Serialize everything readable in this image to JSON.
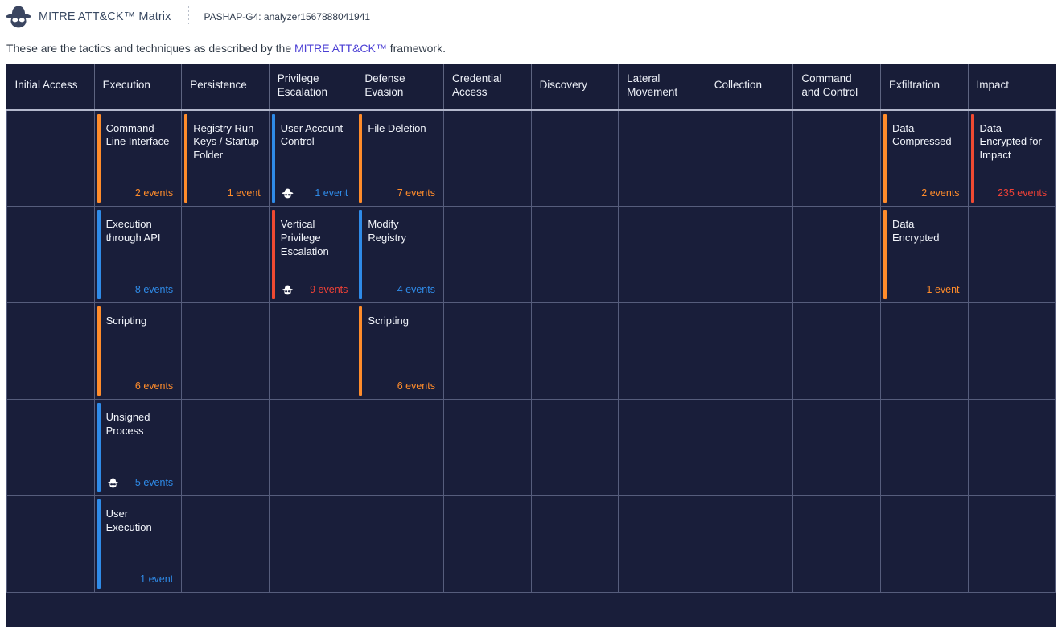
{
  "header": {
    "logo_icon": "spy-icon",
    "title": "MITRE ATT&CK™ Matrix",
    "analyzer_id": "PASHAP-G4: analyzer1567888041941"
  },
  "description": {
    "prefix": "These are the tactics and techniques as described by the ",
    "link_text": "MITRE ATT&CK™",
    "suffix": " framework."
  },
  "colors": {
    "orange": "#ff8c2b",
    "blue": "#2f8be8",
    "red": "#f04a32",
    "red_text": "#ef4136",
    "table_bg": "#191e3a",
    "header_bg": "#181d38",
    "link": "#4b3fd4"
  },
  "matrix": {
    "columns": [
      "Initial Access",
      "Execution",
      "Persistence",
      "Privilege Escalation",
      "Defense Evasion",
      "Credential Access",
      "Discovery",
      "Lateral Movement",
      "Collection",
      "Command and Control",
      "Exfiltration",
      "Impact"
    ],
    "rows": [
      [
        null,
        {
          "name": "Command-Line Interface",
          "events": "2 events",
          "bar": "#ff8c2b",
          "event_color": "#ff8c2b",
          "icon": null
        },
        {
          "name": "Registry Run Keys / Startup Folder",
          "events": "1 event",
          "bar": "#ff8c2b",
          "event_color": "#ff8c2b",
          "icon": null
        },
        {
          "name": "User Account Control",
          "events": "1 event",
          "bar": "#2f8be8",
          "event_color": "#2f8be8",
          "icon": "spy-icon"
        },
        {
          "name": "File Deletion",
          "events": "7 events",
          "bar": "#ff8c2b",
          "event_color": "#ff8c2b",
          "icon": null
        },
        null,
        null,
        null,
        null,
        null,
        {
          "name": "Data Compressed",
          "events": "2 events",
          "bar": "#ff8c2b",
          "event_color": "#ff8c2b",
          "icon": null
        },
        {
          "name": "Data Encrypted for Impact",
          "events": "235 events",
          "bar": "#f04a32",
          "event_color": "#ef4136",
          "icon": null
        }
      ],
      [
        null,
        {
          "name": "Execution through API",
          "events": "8 events",
          "bar": "#2f8be8",
          "event_color": "#2f8be8",
          "icon": null
        },
        null,
        {
          "name": "Vertical Privilege Escalation",
          "events": "9 events",
          "bar": "#f04a32",
          "event_color": "#ef4136",
          "icon": "spy-icon"
        },
        {
          "name": "Modify Registry",
          "events": "4 events",
          "bar": "#2f8be8",
          "event_color": "#2f8be8",
          "icon": null
        },
        null,
        null,
        null,
        null,
        null,
        {
          "name": "Data Encrypted",
          "events": "1 event",
          "bar": "#ff8c2b",
          "event_color": "#ff8c2b",
          "icon": null
        },
        null
      ],
      [
        null,
        {
          "name": "Scripting",
          "events": "6 events",
          "bar": "#ff8c2b",
          "event_color": "#ff8c2b",
          "icon": null
        },
        null,
        null,
        {
          "name": "Scripting",
          "events": "6 events",
          "bar": "#ff8c2b",
          "event_color": "#ff8c2b",
          "icon": null
        },
        null,
        null,
        null,
        null,
        null,
        null,
        null
      ],
      [
        null,
        {
          "name": "Unsigned Process",
          "events": "5 events",
          "bar": "#2f8be8",
          "event_color": "#2f8be8",
          "icon": "spy-icon"
        },
        null,
        null,
        null,
        null,
        null,
        null,
        null,
        null,
        null,
        null
      ],
      [
        null,
        {
          "name": "User Execution",
          "events": "1 event",
          "bar": "#2f8be8",
          "event_color": "#2f8be8",
          "icon": null
        },
        null,
        null,
        null,
        null,
        null,
        null,
        null,
        null,
        null,
        null
      ]
    ]
  }
}
